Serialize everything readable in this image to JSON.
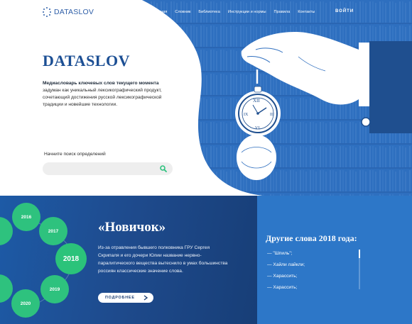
{
  "brand": {
    "logo_text": "DATASLOV"
  },
  "nav": {
    "items": [
      {
        "label": "Главная"
      },
      {
        "label": "Словник"
      },
      {
        "label": "Библиотека"
      },
      {
        "label": "Инструкции и нормы"
      },
      {
        "label": "Правила"
      },
      {
        "label": "Контакты"
      }
    ],
    "login_label": "ВОЙТИ"
  },
  "hero": {
    "title": "DATASLOV",
    "desc_bold": "Медиасловарь ключевых слов текущего момента",
    "desc_rest": " задуман как уникальный лексикографический продукт, сочетающий достижения русской лексикографической традиции и новейшие технологии."
  },
  "search": {
    "label": "Начните поиск определений",
    "value": "",
    "placeholder": ""
  },
  "timeline": {
    "years": [
      "2016",
      "2017",
      "2018",
      "2019",
      "2020"
    ],
    "selected": "2018"
  },
  "word": {
    "title": "«Новичок»",
    "text": "Из-за отравления бывшего полковника ГРУ Сергея Скрипаля и его дочери Юлии название нервно-паралитического вещества вытеснило в умах большинства россиян классические значение слова.",
    "more_label": "ПОДРОБНЕЕ"
  },
  "other_words": {
    "title": "Другие слова 2018 года:",
    "items": [
      "— \"Шпиль\";",
      "— Хайли лайкли;",
      "— Харассить;",
      "— Харассить;"
    ]
  },
  "colors": {
    "hero_blue": "#2f6fbf",
    "brand_blue": "#1c4f94",
    "accent_green": "#2ec27e",
    "lower_left": "#1d4f95",
    "lower_right": "#2d77c8"
  }
}
